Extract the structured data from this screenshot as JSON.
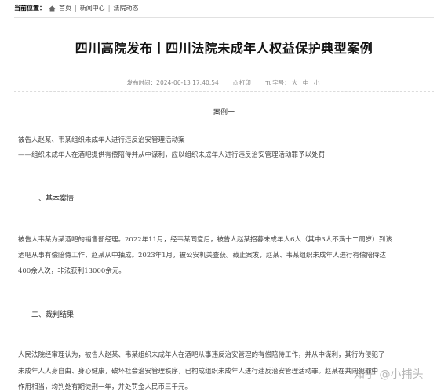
{
  "breadcrumb": {
    "label": "当前位置：",
    "items": [
      "首页",
      "新闻中心",
      "法院动态"
    ],
    "separator": "|"
  },
  "article": {
    "title": "四川高院发布丨四川法院未成年人权益保护典型案例",
    "meta": {
      "source": "发布时间：2024-06-13 17:40:54",
      "print": "打印",
      "font_label": "字号：",
      "sizes": [
        "大",
        "中",
        "小"
      ]
    },
    "case_heading": "案例一",
    "lines": {
      "l1": "被告人赵某、韦某组织未成年人进行违反治安管理活动案",
      "l2": "——组织未成年人在酒吧提供有偿陪侍并从中谋利，应以组织未成年人进行违反治安管理活动罪予以处罚",
      "h1": "一、基本案情",
      "p1a": "被告人韦某为某酒吧的销售部经理。2022年11月，经韦某同意后，被告人赵某招募未成年人6人（其中3人不满十二周岁）到该",
      "p1b": "酒吧从事有偿陪侍工作，赵某从中抽成。2023年1月，被公安机关查获。截止案发，赵某、韦某组织未成年人进行有偿陪侍达",
      "p1c": "400余人次，非法获利13000余元。",
      "h2": "二、裁判结果",
      "p2a": "人民法院经审理认为，被告人赵某、韦某组织未成年人在酒吧从事违反治安管理的有偿陪侍工作，并从中谋利，其行为侵犯了",
      "p2b": "未成年人人身自由、身心健康，破坏社会治安管理秩序，已构成组织未成年人进行违反治安管理活动罪。赵某在共同犯罪中",
      "p2c": "作用相当，均判处有期徒刑一年，并处罚金人民币三千元。"
    }
  },
  "watermark": "知乎 @小捕头",
  "colors": {
    "text": "#333333",
    "meta": "#888888",
    "divider": "#e1e1e1"
  }
}
